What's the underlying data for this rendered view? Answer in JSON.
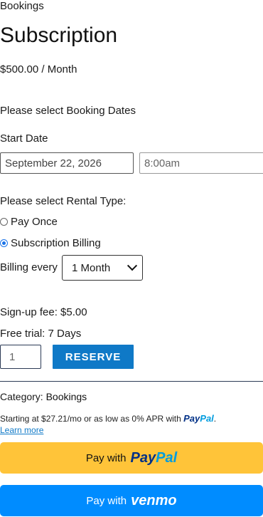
{
  "breadcrumb": "Bookings",
  "product": {
    "title": "Subscription",
    "price": "$500.00 / Month"
  },
  "booking": {
    "dates_heading": "Please select Booking Dates",
    "start_label": "Start Date",
    "start_date": "September 22, 2026",
    "start_time": "8:00am"
  },
  "rental": {
    "heading": "Please select Rental Type:",
    "options": [
      {
        "label": "Pay Once",
        "checked": false
      },
      {
        "label": "Subscription Billing",
        "checked": true
      }
    ],
    "billing_label": "Billing every",
    "billing_value": "1 Month"
  },
  "fees": {
    "signup": "Sign-up fee: $5.00",
    "trial": "Free trial: 7 Days"
  },
  "cart": {
    "quantity": "1",
    "reserve_label": "RESERVE"
  },
  "meta": {
    "category_label": "Category:",
    "category_value": "Bookings"
  },
  "paypal": {
    "message_text": "Starting at $27.21/mo or as low as 0% APR with",
    "message_brand_pay": "Pay",
    "message_brand_pal": "Pal",
    "message_period": ".",
    "learn_more": "Learn more",
    "paypal_button_prefix": "Pay with",
    "paypal_button_pay": "Pay",
    "paypal_button_pal": "Pal",
    "venmo_button_prefix": "Pay with",
    "venmo_button_brand": "venmo",
    "colors": {
      "paypal_button": "#ffc439",
      "venmo_button": "#008cff",
      "reserve": "#0f79c7"
    }
  }
}
